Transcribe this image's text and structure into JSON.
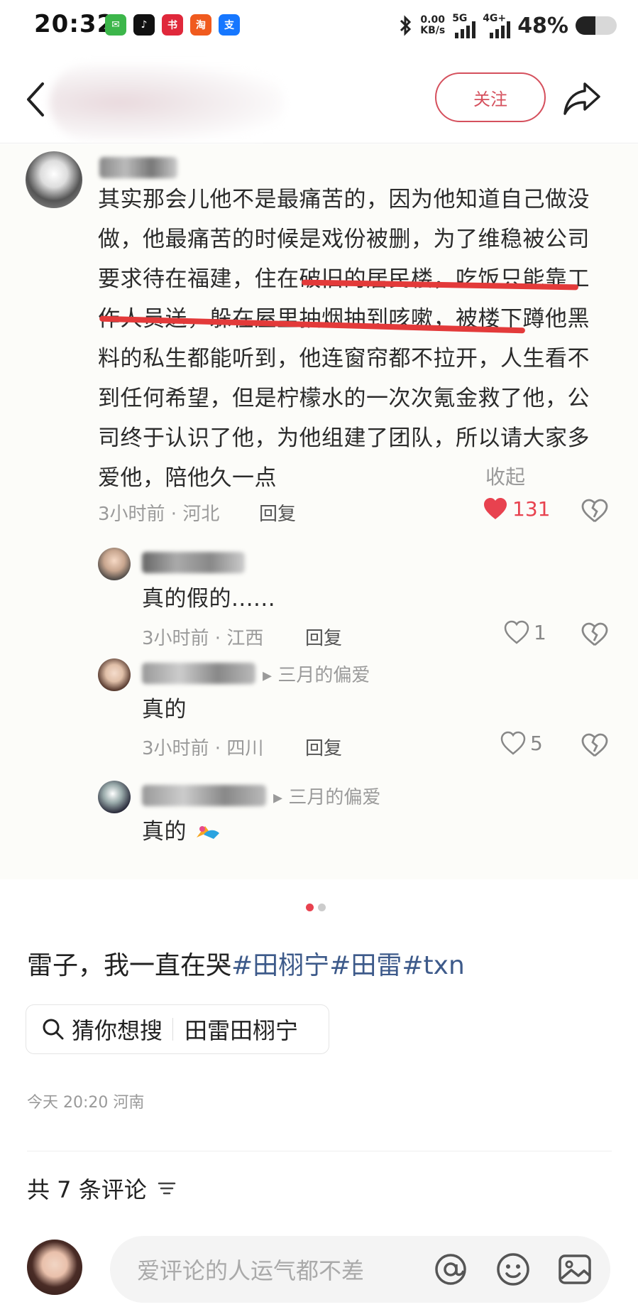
{
  "status_bar": {
    "time": "20:32",
    "net_speed_value": "0.00",
    "net_speed_unit": "KB/s",
    "signal_1": "5G",
    "signal_2": "4G+",
    "battery": "48%",
    "battery_level": 0.48
  },
  "nav": {
    "follow_label": "关注"
  },
  "comments": {
    "main": {
      "text": "其实那会儿他不是最痛苦的，因为他知道自己做没做，他最痛苦的时候是戏份被删，为了维稳被公司要求待在福建，住在破旧的居民楼，吃饭只能靠工作人员送，躲在屋里抽烟抽到咳嗽，被楼下蹲他黑料的私生都能听到，他连窗帘都不拉开，人生看不到任何希望，但是柠檬水的一次次氪金救了他，公司终于认识了他，为他组建了团队，所以请大家多爱他，陪他久一点",
      "collapse": "收起",
      "time_loc": "3小时前 · 河北",
      "reply": "回复",
      "likes": "131"
    },
    "replies": [
      {
        "reply_to": "",
        "text": "真的假的......",
        "time_loc": "3小时前 · 江西",
        "reply": "回复",
        "likes": "1"
      },
      {
        "reply_to": "三月的偏爱",
        "text": "真的",
        "time_loc": "3小时前 · 四川",
        "reply": "回复",
        "likes": "5"
      },
      {
        "reply_to": "三月的偏爱",
        "text": "真的",
        "time_loc": "",
        "reply": "",
        "likes": ""
      }
    ]
  },
  "post": {
    "text": "雷子，我一直在哭",
    "tags": [
      "#田栩宁",
      "#田雷",
      "#txn"
    ],
    "suggest_label": "猜你想搜",
    "suggest_query": "田雷田栩宁",
    "meta": "今天 20:20  河南",
    "comment_count": "共 7 条评论"
  },
  "bottom": {
    "input_placeholder": "爱评论的人运气都不差"
  },
  "colors": {
    "accent": "#d5505d",
    "like_red": "#e8424f",
    "tag_blue": "#3d5a8a"
  }
}
